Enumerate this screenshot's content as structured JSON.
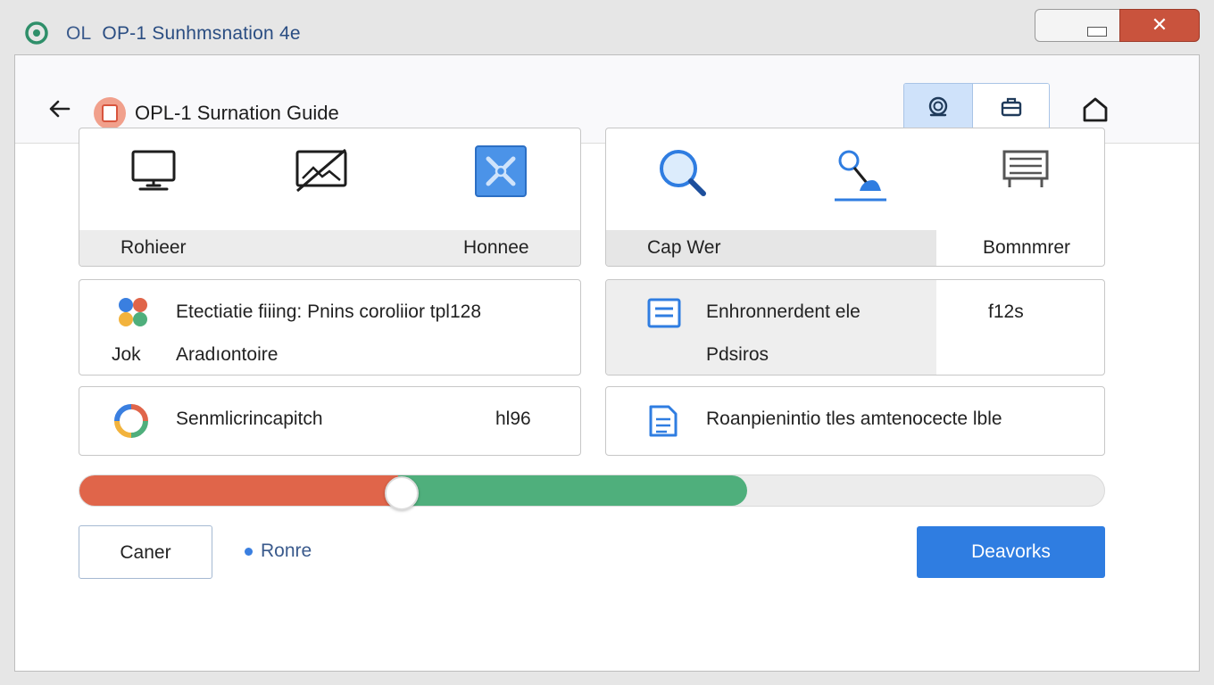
{
  "titlebar": {
    "title_part1": "OL",
    "title_part2": "OP-1 Sunhmsnation 4e",
    "close_glyph": "✕"
  },
  "header": {
    "title": "OPL-1 Surnation Guide",
    "back_icon": "arrow-left-icon",
    "toolbar_icons": [
      "gear-badge-icon",
      "basket-icon"
    ],
    "home_icon": "home-icon"
  },
  "cards": {
    "c1": {
      "labels": [
        "Rohieer",
        "Honnee"
      ],
      "icons": [
        "monitor-icon",
        "image-edit-icon",
        "tools-icon"
      ]
    },
    "c2": {
      "labels": [
        "Cap Wer",
        "Bomnmrer"
      ],
      "icons": [
        "search-icon",
        "pin-user-icon",
        "printer-icon"
      ]
    },
    "c3": {
      "line1": "Etectiatie fiiing: Pnins coroliior tpl128",
      "line2_prefix": "Jok",
      "line2": "Aradıontoire",
      "icon": "petals-icon"
    },
    "c4": {
      "line1": "Enhronnerdent ele",
      "line2": "Pdsiros",
      "value": "f12s",
      "icon": "document-icon"
    },
    "c5": {
      "text": "Senmlicrincapitch",
      "value": "hl96",
      "icon": "sync-icon"
    },
    "c6": {
      "text": "Roanpienintio tles amtenocecte lble",
      "icon": "file-list-icon"
    }
  },
  "progress": {
    "red_fraction": 0.31,
    "green_fraction": 0.65,
    "thumb_fraction": 0.315,
    "colors": {
      "red": "#e0654a",
      "green": "#4faf7c",
      "track": "#ececec"
    }
  },
  "footer": {
    "cancel_label": "Caner",
    "more_label": "Ronre",
    "primary_label": "Deavorks"
  },
  "colors": {
    "accent": "#2f7de1",
    "close": "#c9533d"
  }
}
